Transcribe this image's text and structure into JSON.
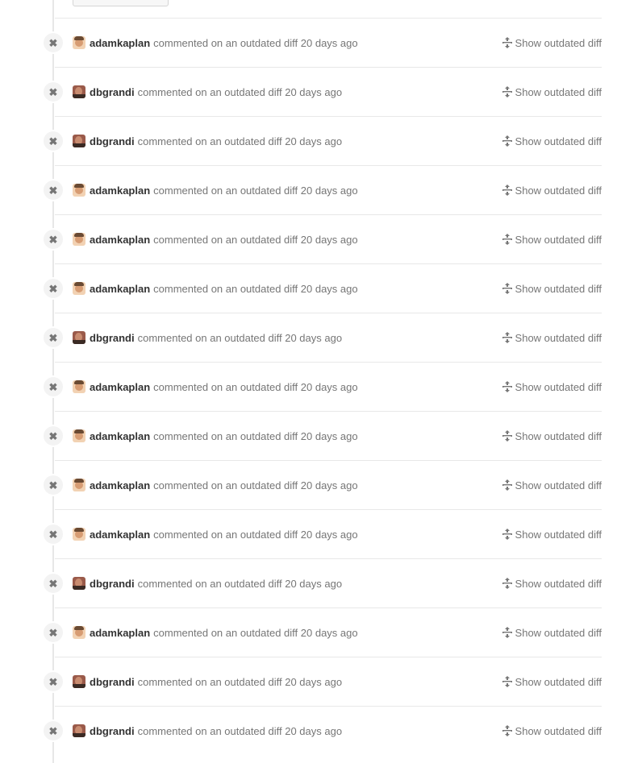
{
  "actions": {
    "show_outdated_diff_label": "Show outdated diff",
    "close_glyph": "✖"
  },
  "icons": {
    "badge": "close-icon",
    "unfold": "unfold-icon"
  },
  "comments": [
    {
      "author": "adamkaplan",
      "avatar": "light",
      "text": "commented on an outdated diff 20 days ago"
    },
    {
      "author": "dbgrandi",
      "avatar": "dark",
      "text": "commented on an outdated diff 20 days ago"
    },
    {
      "author": "dbgrandi",
      "avatar": "dark",
      "text": "commented on an outdated diff 20 days ago"
    },
    {
      "author": "adamkaplan",
      "avatar": "light",
      "text": "commented on an outdated diff 20 days ago"
    },
    {
      "author": "adamkaplan",
      "avatar": "light",
      "text": "commented on an outdated diff 20 days ago"
    },
    {
      "author": "adamkaplan",
      "avatar": "light",
      "text": "commented on an outdated diff 20 days ago"
    },
    {
      "author": "dbgrandi",
      "avatar": "dark",
      "text": "commented on an outdated diff 20 days ago"
    },
    {
      "author": "adamkaplan",
      "avatar": "light",
      "text": "commented on an outdated diff 20 days ago"
    },
    {
      "author": "adamkaplan",
      "avatar": "light",
      "text": "commented on an outdated diff 20 days ago"
    },
    {
      "author": "adamkaplan",
      "avatar": "light",
      "text": "commented on an outdated diff 20 days ago"
    },
    {
      "author": "adamkaplan",
      "avatar": "light",
      "text": "commented on an outdated diff 20 days ago"
    },
    {
      "author": "dbgrandi",
      "avatar": "dark",
      "text": "commented on an outdated diff 20 days ago"
    },
    {
      "author": "adamkaplan",
      "avatar": "light",
      "text": "commented on an outdated diff 20 days ago"
    },
    {
      "author": "dbgrandi",
      "avatar": "dark",
      "text": "commented on an outdated diff 20 days ago"
    },
    {
      "author": "dbgrandi",
      "avatar": "dark",
      "text": "commented on an outdated diff 20 days ago"
    }
  ]
}
